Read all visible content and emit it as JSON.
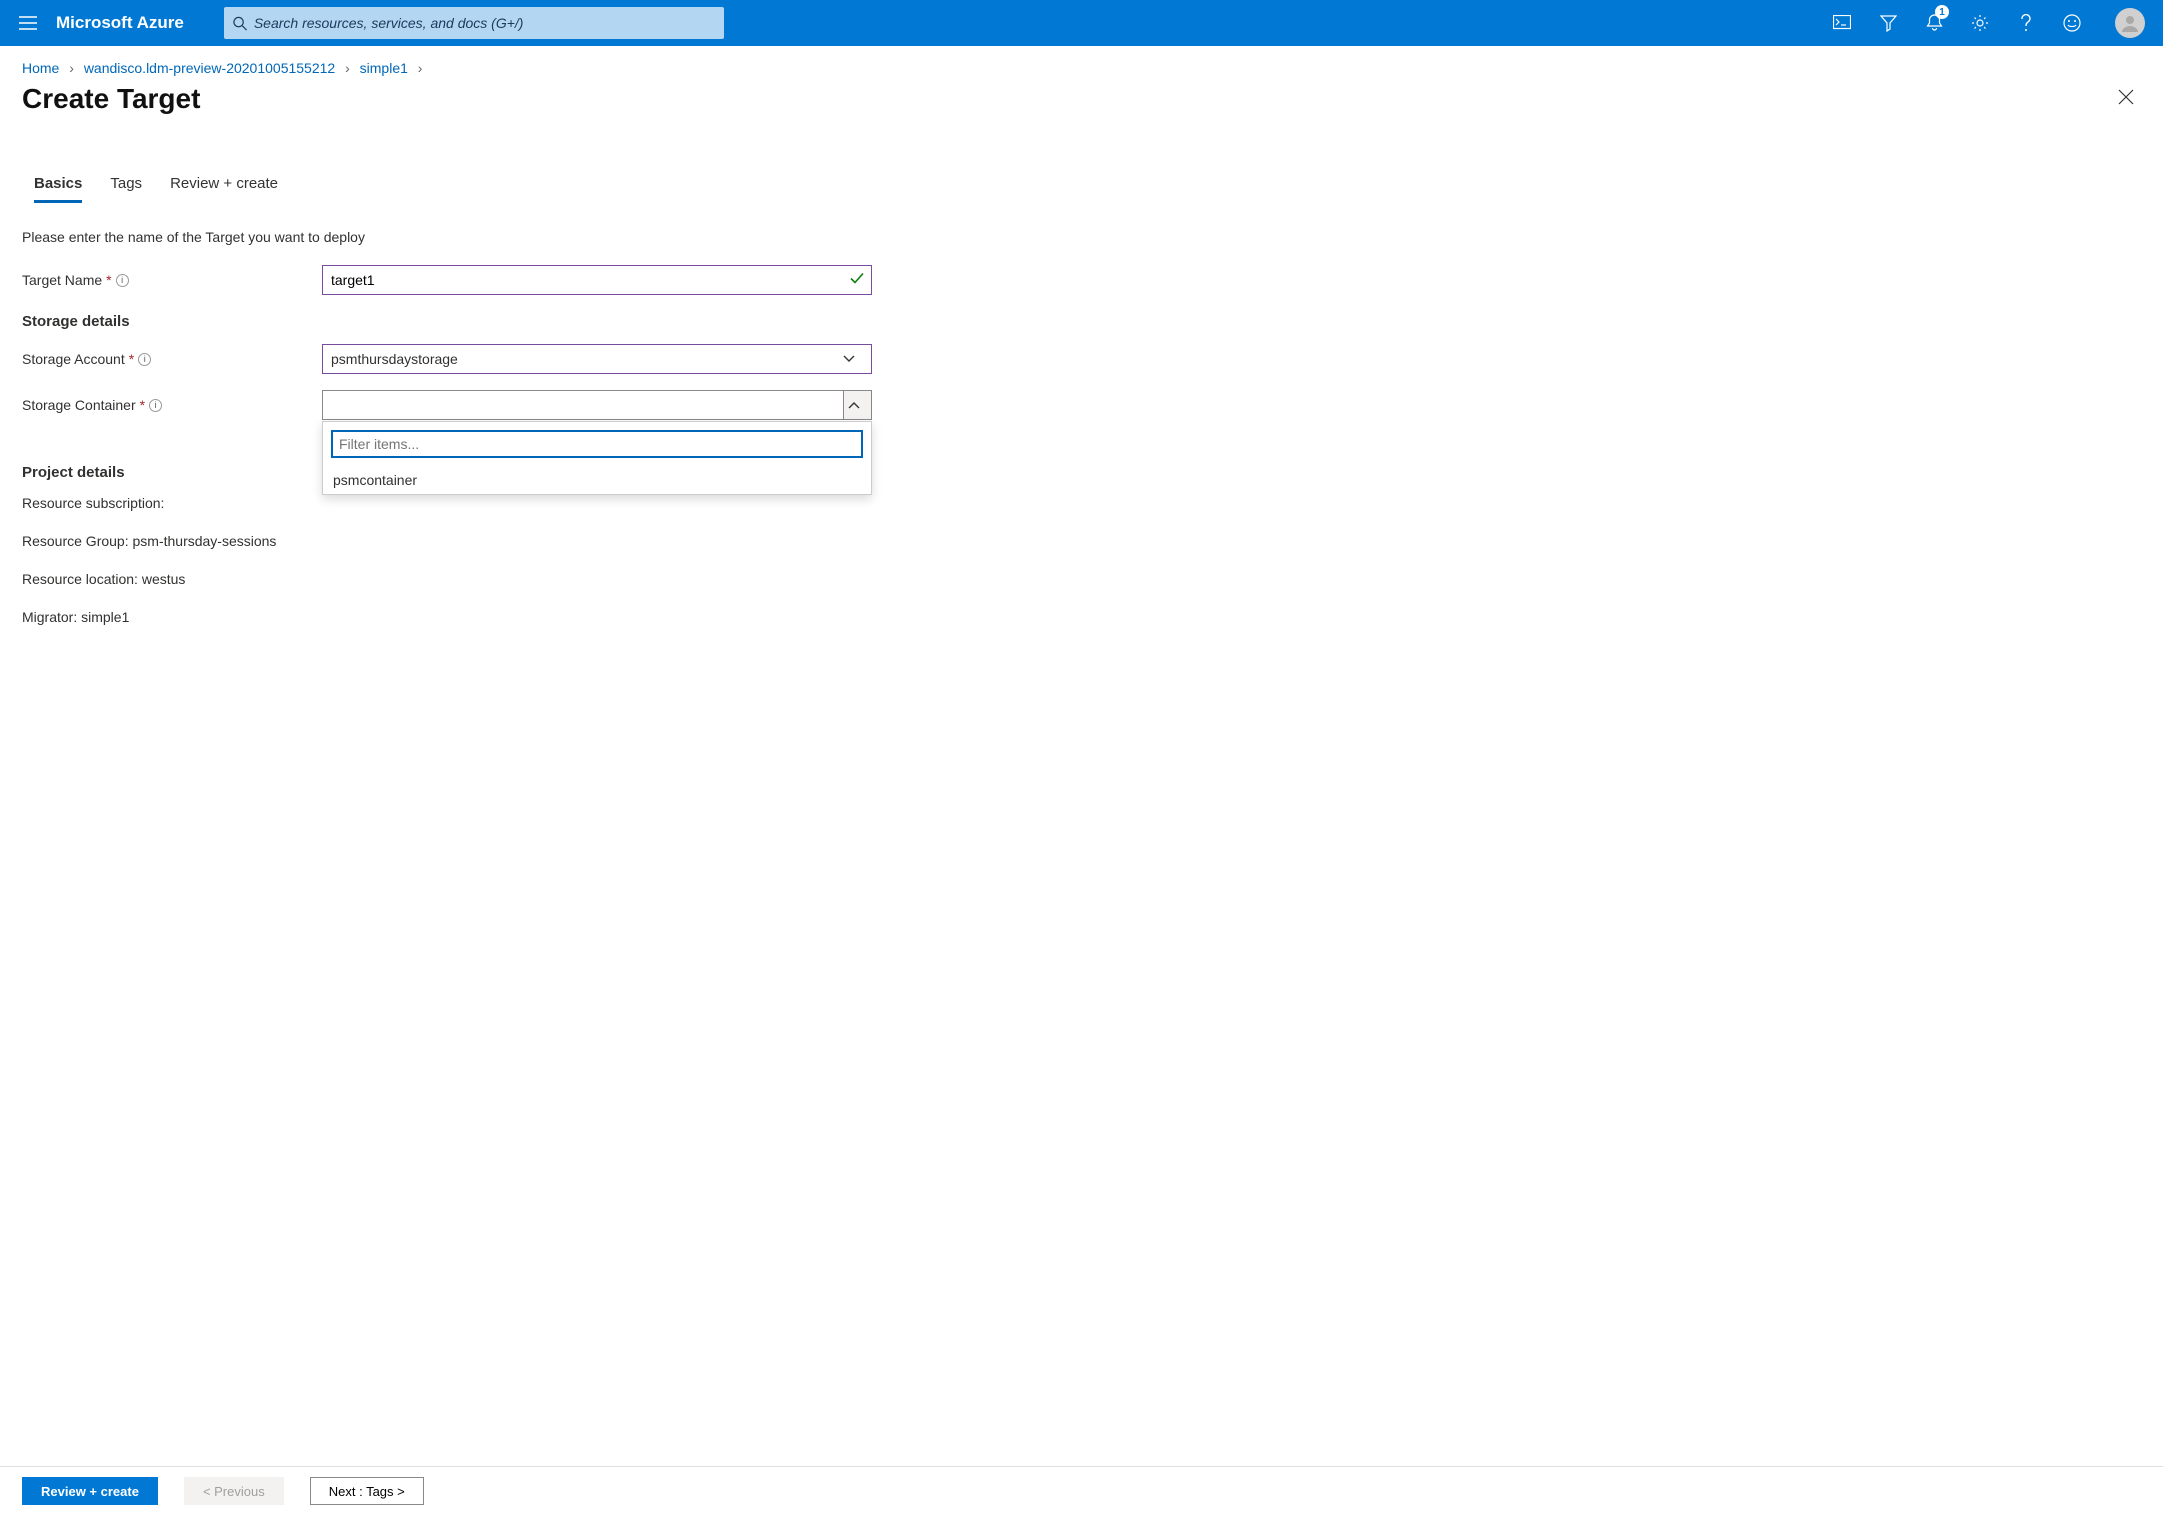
{
  "header": {
    "brand": "Microsoft Azure",
    "search_placeholder": "Search resources, services, and docs (G+/)",
    "notification_count": "1"
  },
  "breadcrumbs": {
    "items": [
      "Home",
      "wandisco.ldm-preview-20201005155212",
      "simple1"
    ]
  },
  "page": {
    "title": "Create Target"
  },
  "tabs": {
    "items": [
      "Basics",
      "Tags",
      "Review + create"
    ],
    "active_index": 0
  },
  "form": {
    "instruction": "Please enter the name of the Target you want to deploy",
    "target_name_label": "Target Name",
    "target_name_value": "target1",
    "storage_section": "Storage details",
    "storage_account_label": "Storage Account",
    "storage_account_value": "psmthursdaystorage",
    "storage_container_label": "Storage Container",
    "storage_container_value": "",
    "filter_placeholder": "Filter items...",
    "container_options": [
      "psmcontainer"
    ],
    "project_section": "Project details",
    "resource_subscription_label": "Resource subscription:",
    "resource_group_line": "Resource Group: psm-thursday-sessions",
    "resource_location_line": "Resource location: westus",
    "migrator_line": "Migrator: simple1"
  },
  "footer": {
    "review_label": "Review + create",
    "prev_label": "< Previous",
    "next_label": "Next : Tags >"
  }
}
